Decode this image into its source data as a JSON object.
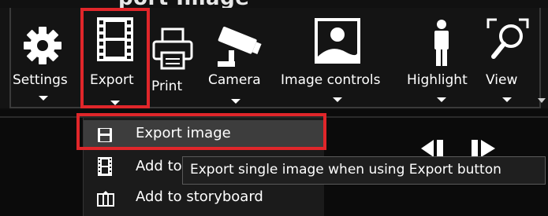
{
  "toolbar": {
    "items": [
      {
        "label": "Settings",
        "icon": "gear-icon"
      },
      {
        "label": "Export",
        "icon": "film-strip-icon"
      },
      {
        "label": "Print",
        "icon": "printer-icon"
      },
      {
        "label": "Camera",
        "icon": "security-camera-icon"
      },
      {
        "label": "Image controls",
        "icon": "landscape-image-icon"
      },
      {
        "label": "Highlight",
        "icon": "person-icon"
      },
      {
        "label": "View",
        "icon": "magnifier-icon"
      }
    ]
  },
  "export_menu": {
    "items": [
      {
        "label": "Export image",
        "icon": "floppy-disk-icon",
        "selected": true
      },
      {
        "label": "Add to",
        "icon": "film-strip-icon",
        "selected": false
      },
      {
        "label": "Add to storyboard",
        "icon": "storyboard-icon",
        "selected": false
      }
    ]
  },
  "tooltip": {
    "text": "Export single image when using Export button"
  },
  "colors": {
    "highlight_box": "#e0262a",
    "toolbar_bg": "#141414",
    "menu_bg": "#1b1b1b",
    "menu_selected_bg": "#3d3d3d"
  }
}
